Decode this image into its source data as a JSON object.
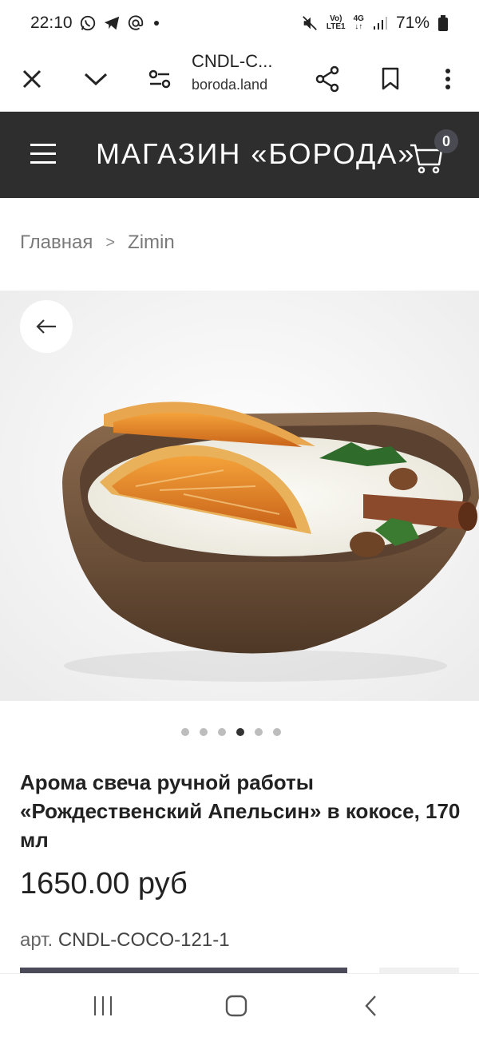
{
  "status_bar": {
    "time": "22:10",
    "battery": "71%",
    "network_top": "Vo)",
    "network_bottom": "LTE1",
    "signal_label": "4G",
    "left_icons": [
      "whatsapp-icon",
      "telegram-icon",
      "at-icon",
      "dot-icon"
    ],
    "right_icons": [
      "mute-icon",
      "volte-icon",
      "4g-icon",
      "signal-icon",
      "battery-icon"
    ]
  },
  "browser": {
    "page_title": "CNDL-C...",
    "domain": "boroda.land",
    "icons": [
      "close-icon",
      "chevron-down-icon",
      "site-settings-icon",
      "share-icon",
      "bookmark-icon",
      "more-icon"
    ]
  },
  "header": {
    "store_title": "МАГАЗИН «БОРОДА»",
    "cart_count": "0",
    "bg_color": "#2e2e2e"
  },
  "breadcrumb": {
    "home": "Главная",
    "separator": ">",
    "current": "Zimin"
  },
  "gallery": {
    "total_images": 6,
    "active_index": 3
  },
  "product": {
    "title": "Арома свеча ручной работы «Рождественский Апельсин» в кокосе, 170 мл",
    "price": "1650.00 руб",
    "sku_label": "арт.",
    "sku": "CNDL-COCO-121-1",
    "button_color": "#4a4a58"
  }
}
